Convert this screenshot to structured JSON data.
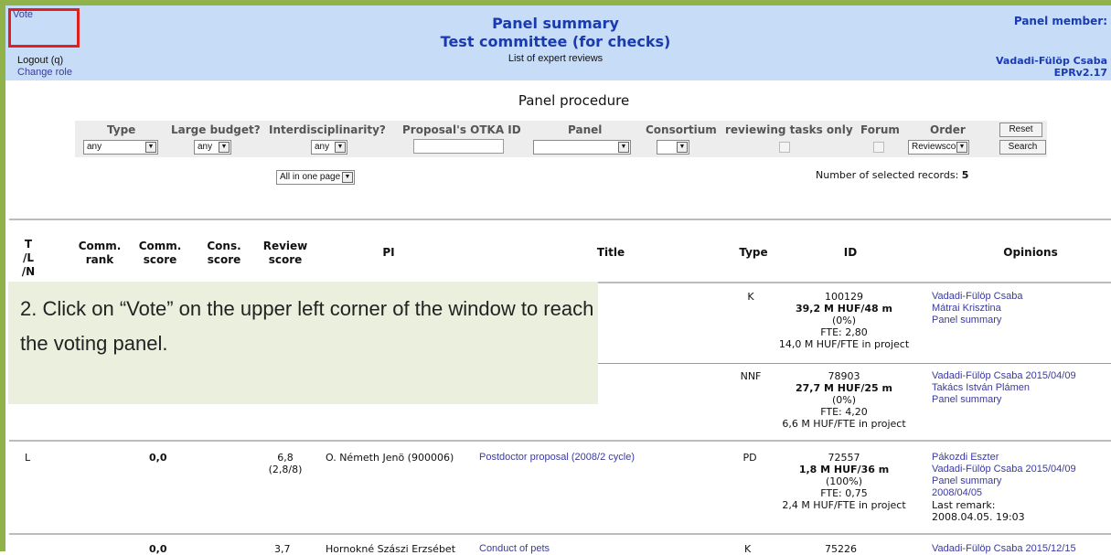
{
  "header": {
    "vote_link": "Vote",
    "title": "Panel summary",
    "subtitle": "Test committee (for checks)",
    "section_label": "List of expert reviews",
    "logout": "Logout (q)",
    "change_role": "Change role",
    "panel_member_label": "Panel member:",
    "member_name": "Vadadi-Fülöp Csaba",
    "version": "EPRv2.17"
  },
  "page_title": "Panel procedure",
  "filters": {
    "type_label": "Type",
    "type_value": "any",
    "large_budget_label": "Large budget?",
    "large_budget_value": "any",
    "interdisc_label": "Interdisciplinarity?",
    "interdisc_value": "any",
    "otka_id_label": "Proposal's OTKA ID",
    "otka_id_value": "",
    "panel_label": "Panel",
    "panel_value": "",
    "consortium_label": "Consortium",
    "consortium_value": "",
    "reviewing_label": "reviewing tasks only",
    "forum_label": "Forum",
    "order_label": "Order",
    "order_value": "Reviewscore",
    "reset_button": "Reset",
    "search_button": "Search",
    "paging_value": "All in one page"
  },
  "records": {
    "label": "Number of selected records:",
    "count": "5"
  },
  "columns": {
    "tln": [
      "T",
      "/L",
      "/N"
    ],
    "comm_rank": [
      "Comm.",
      "rank"
    ],
    "comm_score": [
      "Comm.",
      "score"
    ],
    "cons_score": [
      "Cons.",
      "score"
    ],
    "review_score": [
      "Review",
      "score"
    ],
    "pi": "PI",
    "title": "Title",
    "type": "Type",
    "id": "ID",
    "opinions": "Opinions"
  },
  "rows": [
    {
      "type": "K",
      "id": "100129",
      "budget": "39,2 M HUF/48 m",
      "pct": "(0%)",
      "fte": "FTE: 2,80",
      "per_fte": "14,0 M HUF/FTE in project",
      "opinions": [
        "Vadadi-Fülöp Csaba",
        "Mátrai Krisztina",
        "Panel summary"
      ]
    },
    {
      "type": "NNF",
      "id": "78903",
      "budget": "27,7 M HUF/25 m",
      "pct": "(0%)",
      "fte": "FTE: 4,20",
      "per_fte": "6,6 M HUF/FTE in project",
      "opinions": [
        "Vadadi-Fülöp Csaba 2015/04/09",
        "Takács István Plámen",
        "Panel summary"
      ]
    },
    {
      "tln": "L",
      "comm_score": "0,0",
      "review_score": "6,8",
      "review_detail": "(2,8/8)",
      "pi": "O. Németh Jenö (900006)",
      "title": "Postdoctor proposal (2008/2 cycle)",
      "type": "PD",
      "id": "72557",
      "budget": "1,8 M HUF/36 m",
      "pct": "(100%)",
      "fte": "FTE: 0,75",
      "per_fte": "2,4 M HUF/FTE in project",
      "opinions": [
        "Pákozdi Eszter",
        "Vadadi-Fülöp Csaba 2015/04/09",
        "Panel summary",
        " 2008/04/05"
      ],
      "remark_label": "Last remark:",
      "remark_date": "2008.04.05. 19:03"
    },
    {
      "comm_score": "0,0",
      "review_score": "3,7",
      "pi": "Hornokné Szászi Erzsébet",
      "title": "Conduct of pets",
      "type": "K",
      "id": "75226",
      "opinions": [
        "Vadadi-Fülöp Csaba 2015/12/15"
      ]
    }
  ],
  "callout": {
    "text": "2. Click on “Vote” on the upper left corner of the window to reach the voting panel."
  },
  "colors": {
    "header_bg": "#c6dcf7",
    "frame": "#8fb34a",
    "highlight": "#e02020",
    "callout_bg": "#ebf0de",
    "link": "#3a3aa0"
  }
}
